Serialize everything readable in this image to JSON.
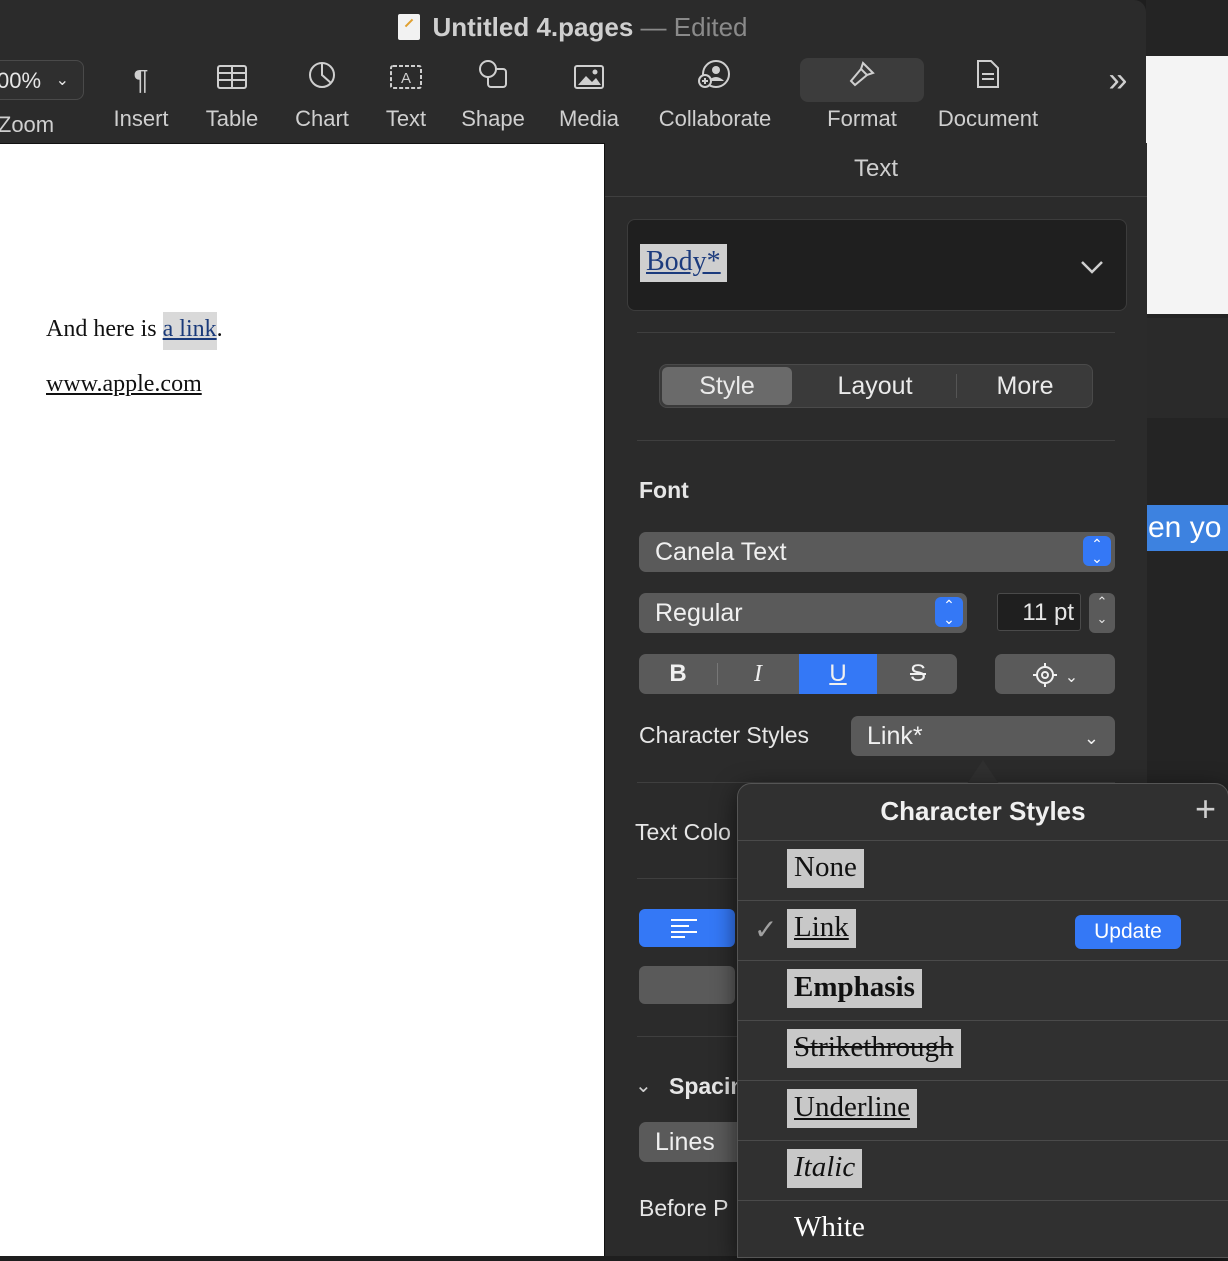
{
  "window": {
    "title": "Untitled 4.pages",
    "separator": "—",
    "status": "Edited"
  },
  "toolbar": {
    "zoom_value": "00%",
    "zoom_label": "Zoom",
    "items": [
      {
        "label": "Insert",
        "icon": "pilcrow-icon"
      },
      {
        "label": "Table",
        "icon": "table-icon"
      },
      {
        "label": "Chart",
        "icon": "chart-icon"
      },
      {
        "label": "Text",
        "icon": "textbox-icon"
      },
      {
        "label": "Shape",
        "icon": "shape-icon"
      },
      {
        "label": "Media",
        "icon": "media-icon"
      },
      {
        "label": "Collaborate",
        "icon": "collaborate-icon"
      },
      {
        "label": "Format",
        "icon": "paintbrush-icon"
      },
      {
        "label": "Document",
        "icon": "document-icon"
      }
    ],
    "overflow": "»"
  },
  "document": {
    "line1_before": "And here is ",
    "line1_link": "a link",
    "line1_after": ".",
    "line2": "www.apple.com"
  },
  "background_window": {
    "partial_text": "en yo"
  },
  "inspector": {
    "header": "Text",
    "paragraph_style": "Body*",
    "tabs": [
      "Style",
      "Layout",
      "More"
    ],
    "font_section": "Font",
    "font_name": "Canela Text",
    "font_weight": "Regular",
    "font_size": "11 pt",
    "format_buttons": [
      "B",
      "I",
      "U",
      "S"
    ],
    "character_styles_label": "Character Styles",
    "character_style_value": "Link*",
    "text_color_label": "Text Colo",
    "spacing_label": "Spacin",
    "lines_value": "Lines",
    "before_label": "Before P"
  },
  "popover": {
    "title": "Character Styles",
    "add": "+",
    "update_label": "Update",
    "items": [
      "None",
      "Link",
      "Emphasis",
      "Strikethrough",
      "Underline",
      "Italic",
      "White"
    ]
  },
  "colors": {
    "accent": "#3478f6",
    "link": "#1c3b7d"
  }
}
